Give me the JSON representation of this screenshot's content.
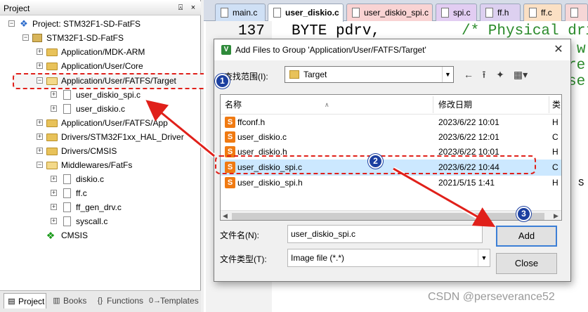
{
  "project_panel": {
    "title": "Project",
    "pin_glyph": "p",
    "close_glyph": "×",
    "tree": [
      {
        "label": "Project: STM32F1-SD-FatFS",
        "icon": "project-icon",
        "level": 0
      },
      {
        "label": "STM32F1-SD-FatFS",
        "icon": "target-icon",
        "level": 1
      },
      {
        "label": "Application/MDK-ARM",
        "icon": "folder-icon",
        "level": 2
      },
      {
        "label": "Application/User/Core",
        "icon": "folder-icon",
        "level": 2
      },
      {
        "label": "Application/User/FATFS/Target",
        "icon": "folder-open-icon",
        "level": 2
      },
      {
        "label": "user_diskio_spi.c",
        "icon": "file-icon",
        "level": 3
      },
      {
        "label": "user_diskio.c",
        "icon": "file-icon",
        "level": 3
      },
      {
        "label": "Application/User/FATFS/App",
        "icon": "folder-icon",
        "level": 2
      },
      {
        "label": "Drivers/STM32F1xx_HAL_Driver",
        "icon": "folder-icon",
        "level": 2
      },
      {
        "label": "Drivers/CMSIS",
        "icon": "folder-icon",
        "level": 2
      },
      {
        "label": "Middlewares/FatFs",
        "icon": "folder-open-icon",
        "level": 2
      },
      {
        "label": "diskio.c",
        "icon": "file-icon",
        "level": 3
      },
      {
        "label": "ff.c",
        "icon": "file-icon",
        "level": 3
      },
      {
        "label": "ff_gen_drv.c",
        "icon": "file-icon",
        "level": 3
      },
      {
        "label": "syscall.c",
        "icon": "file-icon",
        "level": 3
      },
      {
        "label": "CMSIS",
        "icon": "cmsis-icon",
        "level": 2
      }
    ],
    "bottom_tabs": [
      {
        "label": "Project",
        "icon": "project-tab-icon"
      },
      {
        "label": "Books",
        "icon": "books-icon"
      },
      {
        "label": "Functions",
        "icon": "functions-icon"
      },
      {
        "label": "Templates",
        "icon": "templates-icon"
      }
    ]
  },
  "editor": {
    "tabs": [
      {
        "label": "main.c",
        "color": "#cfe0f5"
      },
      {
        "label": "user_diskio.c",
        "color": "#ffffff"
      },
      {
        "label": "user_diskio_spi.c",
        "color": "#f9d3d3"
      },
      {
        "label": "spi.c",
        "color": "#e2cdf2"
      },
      {
        "label": "ff.h",
        "color": "#ddd0f0"
      },
      {
        "label": "ff.c",
        "color": "#fbe0c4"
      },
      {
        "label": "",
        "color": "#f6d6d6"
      }
    ],
    "code": {
      "line_number": "137",
      "text": "BYTE pdrv,",
      "comment": "/* Physical dri",
      "fragments": [
        "w",
        "re",
        "se",
        "S"
      ]
    }
  },
  "dialog": {
    "title": "Add Files to Group 'Application/User/FATFS/Target'",
    "look_in_label": "查找范围(I):",
    "look_in_value": "Target",
    "columns": {
      "name": "名称",
      "date": "修改日期",
      "type": "类"
    },
    "files": [
      {
        "name": "ffconf.h",
        "date": "2023/6/22 10:01",
        "type": "H"
      },
      {
        "name": "user_diskio.c",
        "date": "2023/6/22 12:01",
        "type": "C"
      },
      {
        "name": "user_diskio.h",
        "date": "2023/6/22 10:01",
        "type": "H"
      },
      {
        "name": "user_diskio_spi.c",
        "date": "2023/6/22 10:44",
        "type": "C"
      },
      {
        "name": "user_diskio_spi.h",
        "date": "2021/5/15 1:41",
        "type": "H"
      }
    ],
    "selected_index": 3,
    "file_name_label": "文件名(N):",
    "file_name_value": "user_diskio_spi.c",
    "file_type_label": "文件类型(T):",
    "file_type_value": "Image file (*.*)",
    "add_label": "Add",
    "close_label": "Close"
  },
  "annotations": {
    "badges": [
      "1",
      "2",
      "3"
    ],
    "color": "#e0201a"
  },
  "watermark": "CSDN @perseverance52"
}
